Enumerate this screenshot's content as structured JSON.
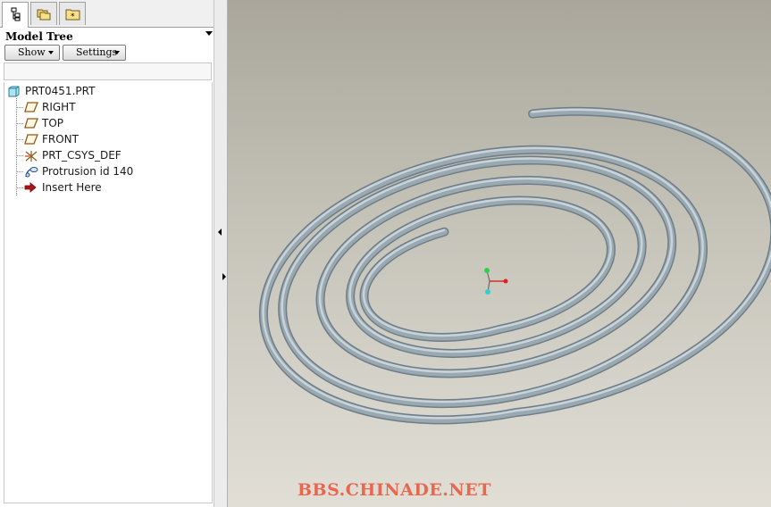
{
  "tabs": [
    {
      "name": "model-tree",
      "icon": "tree-structure-icon",
      "active": true
    },
    {
      "name": "folder-browser",
      "icon": "folders-icon",
      "active": false
    },
    {
      "name": "favorites",
      "icon": "favorites-folder-icon",
      "active": false
    }
  ],
  "model_tree": {
    "title": "Model Tree",
    "show_label": "Show",
    "settings_label": "Settings",
    "root": {
      "label": "PRT0451.PRT",
      "icon": "part-icon"
    },
    "items": [
      {
        "label": "RIGHT",
        "icon": "datum-plane-icon"
      },
      {
        "label": "TOP",
        "icon": "datum-plane-icon"
      },
      {
        "label": "FRONT",
        "icon": "datum-plane-icon"
      },
      {
        "label": "PRT_CSYS_DEF",
        "icon": "coordinate-system-icon"
      },
      {
        "label": "Protrusion id 140",
        "icon": "sweep-protrusion-icon"
      },
      {
        "label": "Insert Here",
        "icon": "insert-arrow-icon"
      }
    ]
  },
  "viewport": {
    "watermark": "BBS.CHINADE.NET",
    "colors": {
      "tube": "#8c9aa4",
      "tube_highlight": "#c9d3da",
      "background_top": "#a9a69c",
      "background_bottom": "#e1ded6"
    }
  }
}
